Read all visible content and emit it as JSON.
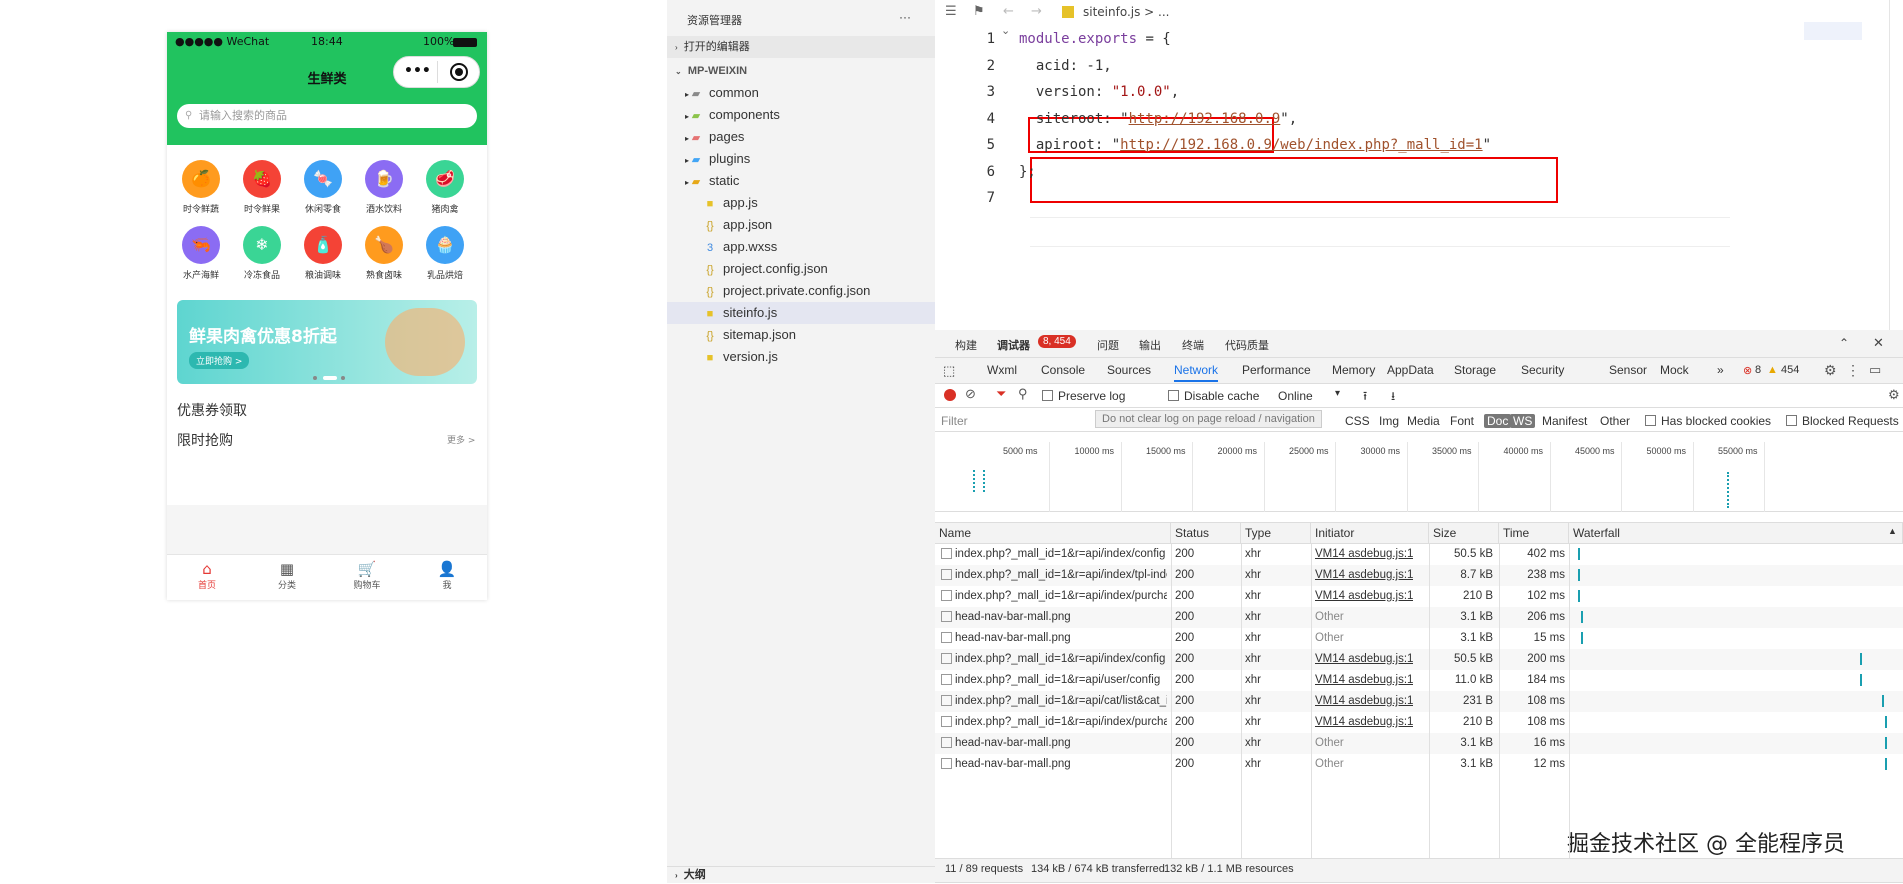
{
  "phone": {
    "carrier": "●●●●● WeChat",
    "time": "18:44",
    "battery": "100%",
    "title": "生鲜类",
    "search_placeholder": "请输入搜索的商品",
    "categories": [
      {
        "label": "时令鲜蔬",
        "color": "#ff9b1e",
        "icon": "🍊"
      },
      {
        "label": "时令鲜果",
        "color": "#f44336",
        "icon": "🍓"
      },
      {
        "label": "休闲零食",
        "color": "#3fa2f5",
        "icon": "🍬"
      },
      {
        "label": "酒水饮料",
        "color": "#8b6cf3",
        "icon": "🍺"
      },
      {
        "label": "猪肉禽",
        "color": "#3ad595",
        "icon": "🥩"
      },
      {
        "label": "水产海鲜",
        "color": "#8b6cf3",
        "icon": "🦐"
      },
      {
        "label": "冷冻食品",
        "color": "#3ad595",
        "icon": "❄"
      },
      {
        "label": "粮油调味",
        "color": "#f44336",
        "icon": "🧴"
      },
      {
        "label": "熟食卤味",
        "color": "#ff9b1e",
        "icon": "🍗"
      },
      {
        "label": "乳品烘焙",
        "color": "#3fa2f5",
        "icon": "🧁"
      }
    ],
    "banner_text": "鲜果肉禽优惠8折起",
    "banner_button": "立即抢购 >",
    "coupon": "优惠券领取",
    "flash": "限时抢购",
    "more": "更多 >",
    "tabs": [
      {
        "label": "首页",
        "icon": "home-icon",
        "glyph": "⌂"
      },
      {
        "label": "分类",
        "icon": "grid-icon",
        "glyph": "▦"
      },
      {
        "label": "购物车",
        "icon": "cart-icon",
        "glyph": "🛒"
      },
      {
        "label": "我",
        "icon": "user-icon",
        "glyph": "👤"
      }
    ]
  },
  "explorer": {
    "title": "资源管理器",
    "more": "···",
    "open_editors": "打开的编辑器",
    "project": "MP-WEIXIN",
    "items": [
      {
        "name": "common",
        "type": "folder",
        "icon": "▰"
      },
      {
        "name": "components",
        "type": "folder",
        "icon": "▰"
      },
      {
        "name": "pages",
        "type": "folder",
        "icon": "▰"
      },
      {
        "name": "plugins",
        "type": "folder",
        "icon": "▰"
      },
      {
        "name": "static",
        "type": "folder",
        "icon": "▰"
      },
      {
        "name": "app.js",
        "type": "js",
        "icon": "■"
      },
      {
        "name": "app.json",
        "type": "json",
        "icon": "{}"
      },
      {
        "name": "app.wxss",
        "type": "css",
        "icon": "3"
      },
      {
        "name": "project.config.json",
        "type": "json",
        "icon": "{}"
      },
      {
        "name": "project.private.config.json",
        "type": "json",
        "icon": "{}"
      },
      {
        "name": "siteinfo.js",
        "type": "js",
        "icon": "■"
      },
      {
        "name": "sitemap.json",
        "type": "json",
        "icon": "{}"
      },
      {
        "name": "version.js",
        "type": "js",
        "icon": "■"
      }
    ],
    "outline": "大纲"
  },
  "editor": {
    "breadcrumb": "siteinfo.js > ...",
    "lines": [
      "module.exports = {",
      "  acid: -1,",
      "  version: \"1.0.0\",",
      "  siteroot: \"http://192.168.0.9\",",
      "  apiroot: \"http://192.168.0.9/web/index.php?_mall_id=1\"",
      "};",
      ""
    ],
    "line_numbers": [
      "1",
      "2",
      "3",
      "4",
      "5",
      "6",
      "7"
    ]
  },
  "devtools": {
    "top_tabs": [
      "构建",
      "调试器",
      "问题",
      "输出",
      "终端",
      "代码质量"
    ],
    "badge": "8, 454",
    "panel_tabs": [
      "Wxml",
      "Console",
      "Sources",
      "Network",
      "Performance",
      "Memory",
      "AppData",
      "Storage",
      "Security",
      "Sensor",
      "Mock"
    ],
    "errors": "8",
    "warnings": "454",
    "preserve_log": "Preserve log",
    "disable_cache": "Disable cache",
    "throttle": "Online",
    "filter_placeholder": "Filter",
    "tooltip": "Do not clear log on page reload / navigation",
    "type_filters": [
      "CSS",
      "Img",
      "Media",
      "Font",
      "Doc",
      "WS",
      "Manifest",
      "Other"
    ],
    "blocked_cookies": "Has blocked cookies",
    "blocked_requests": "Blocked Requests",
    "timeline": [
      "5000 ms",
      "10000 ms",
      "15000 ms",
      "20000 ms",
      "25000 ms",
      "30000 ms",
      "35000 ms",
      "40000 ms",
      "45000 ms",
      "50000 ms",
      "55000 ms"
    ],
    "columns": [
      "Name",
      "Status",
      "Type",
      "Initiator",
      "Size",
      "Time",
      "Waterfall"
    ],
    "rows": [
      {
        "name": "index.php?_mall_id=1&r=api/index/config",
        "status": "200",
        "type": "xhr",
        "initiator": "VM14 asdebug.js:1",
        "size": "50.5 kB",
        "time": "402 ms",
        "wf": 0.01
      },
      {
        "name": "index.php?_mall_id=1&r=api/index/tpl-index&...",
        "status": "200",
        "type": "xhr",
        "initiator": "VM14 asdebug.js:1",
        "size": "8.7 kB",
        "time": "238 ms",
        "wf": 0.01
      },
      {
        "name": "index.php?_mall_id=1&r=api/index/purchase",
        "status": "200",
        "type": "xhr",
        "initiator": "VM14 asdebug.js:1",
        "size": "210 B",
        "time": "102 ms",
        "wf": 0.01
      },
      {
        "name": "head-nav-bar-mall.png",
        "status": "200",
        "type": "xhr",
        "initiator": "Other",
        "size": "3.1 kB",
        "time": "206 ms",
        "wf": 0.02
      },
      {
        "name": "head-nav-bar-mall.png",
        "status": "200",
        "type": "xhr",
        "initiator": "Other",
        "size": "3.1 kB",
        "time": "15 ms",
        "wf": 0.02
      },
      {
        "name": "index.php?_mall_id=1&r=api/index/config",
        "status": "200",
        "type": "xhr",
        "initiator": "VM14 asdebug.js:1",
        "size": "50.5 kB",
        "time": "200 ms",
        "wf": 0.89
      },
      {
        "name": "index.php?_mall_id=1&r=api/user/config",
        "status": "200",
        "type": "xhr",
        "initiator": "VM14 asdebug.js:1",
        "size": "11.0 kB",
        "time": "184 ms",
        "wf": 0.89
      },
      {
        "name": "index.php?_mall_id=1&r=api/cat/list&cat_id=...",
        "status": "200",
        "type": "xhr",
        "initiator": "VM14 asdebug.js:1",
        "size": "231 B",
        "time": "108 ms",
        "wf": 0.96
      },
      {
        "name": "index.php?_mall_id=1&r=api/index/purchase",
        "status": "200",
        "type": "xhr",
        "initiator": "VM14 asdebug.js:1",
        "size": "210 B",
        "time": "108 ms",
        "wf": 0.97
      },
      {
        "name": "head-nav-bar-mall.png",
        "status": "200",
        "type": "xhr",
        "initiator": "Other",
        "size": "3.1 kB",
        "time": "16 ms",
        "wf": 0.97
      },
      {
        "name": "head-nav-bar-mall.png",
        "status": "200",
        "type": "xhr",
        "initiator": "Other",
        "size": "3.1 kB",
        "time": "12 ms",
        "wf": 0.97
      }
    ],
    "summary": [
      "11 / 89 requests",
      "134 kB / 674 kB transferred",
      "132 kB / 1.1 MB resources"
    ]
  },
  "watermark": "掘金技术社区 @ 全能程序员"
}
